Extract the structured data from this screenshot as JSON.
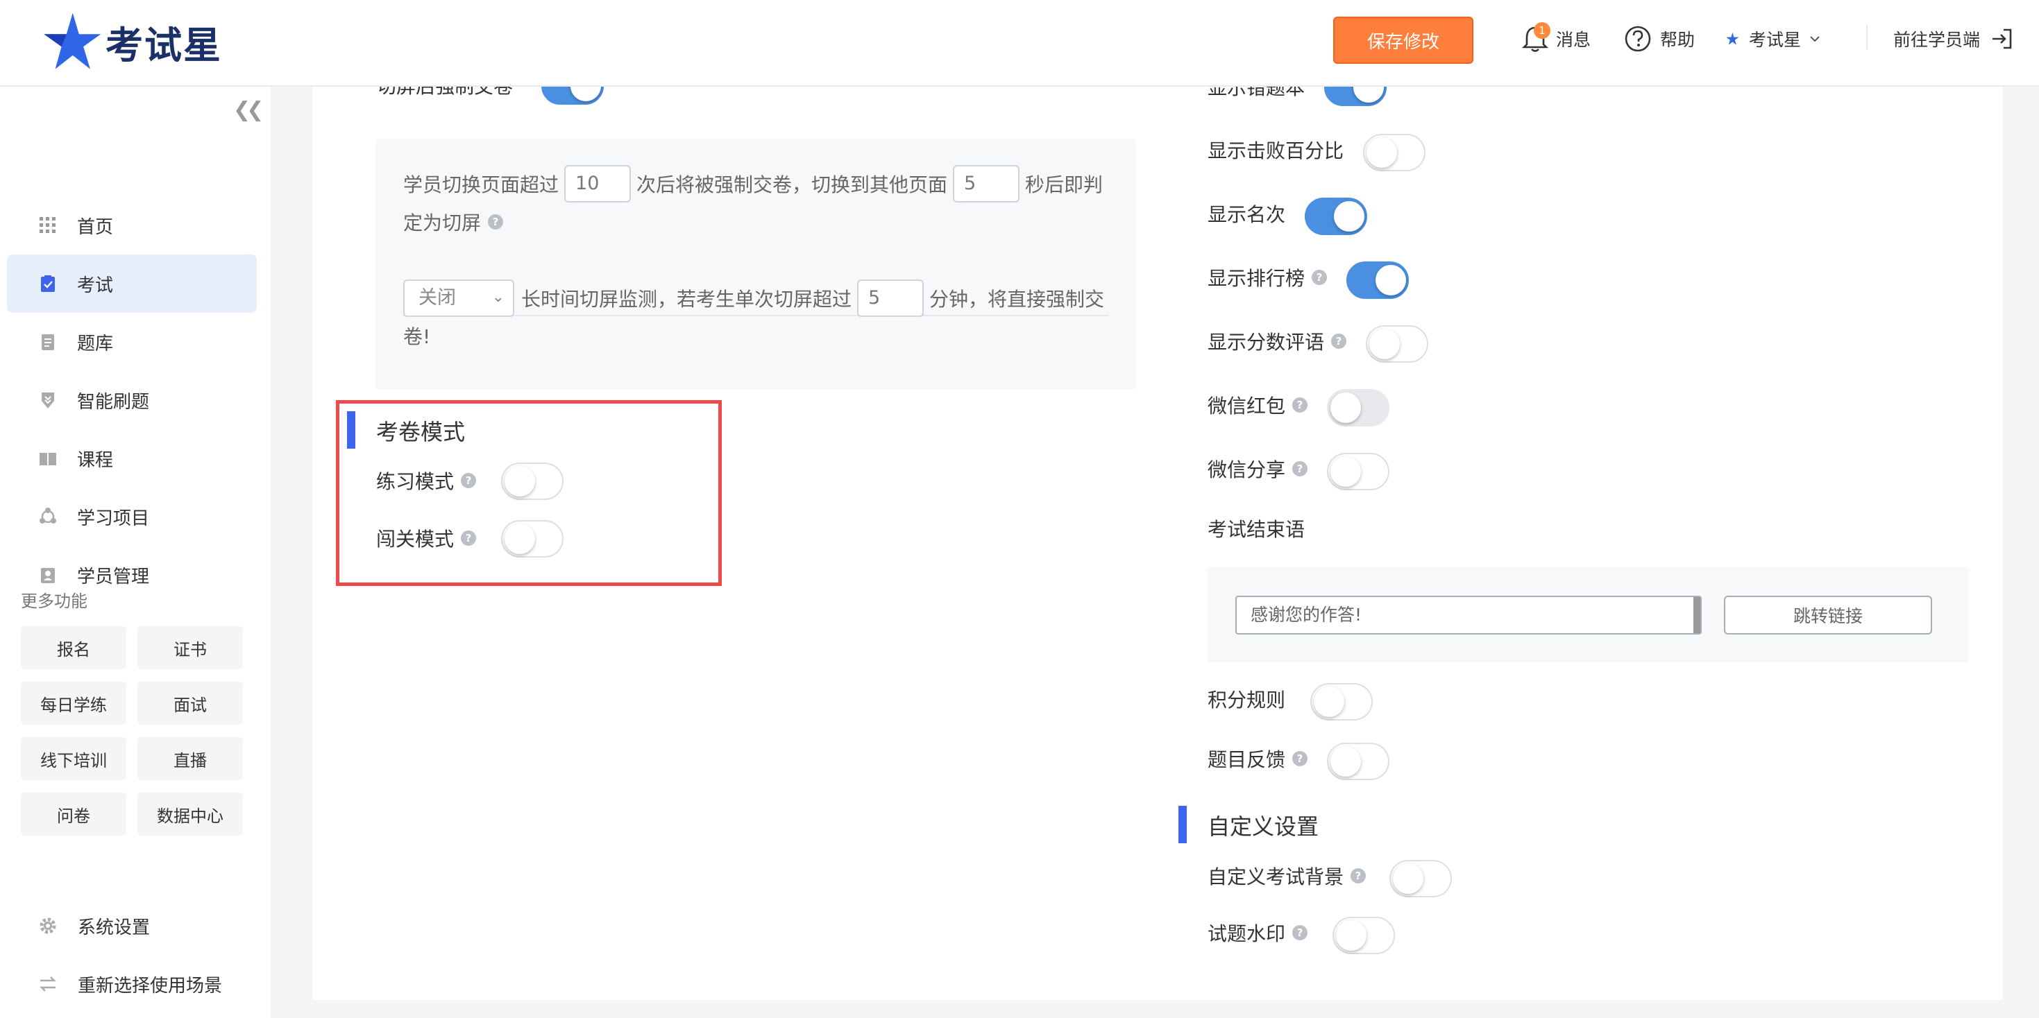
{
  "header": {
    "logo_text": "考试星",
    "save_label": "保存修改",
    "message_label": "消息",
    "message_badge": "1",
    "help_label": "帮助",
    "account_label": "考试星",
    "student_label": "前往学员端"
  },
  "sidebar": {
    "items": [
      {
        "label": "首页"
      },
      {
        "label": "考试",
        "active": true
      },
      {
        "label": "题库"
      },
      {
        "label": "智能刷题"
      },
      {
        "label": "课程"
      },
      {
        "label": "学习项目"
      },
      {
        "label": "学员管理"
      }
    ],
    "more_label": "更多功能",
    "more_items": [
      "报名",
      "证书",
      "每日学练",
      "面试",
      "线下培训",
      "直播",
      "问卷",
      "数据中心"
    ],
    "settings_label": "系统设置",
    "switch_label": "重新选择使用场景"
  },
  "left": {
    "force_submit_label": "切屏后强制交卷",
    "force_submit_on": true,
    "switch_text_1": "学员切换页面超过",
    "switch_count": "10",
    "switch_text_2": "次后将被强制交卷，切换到其他页面",
    "switch_seconds": "5",
    "switch_text_3": "秒后即判",
    "switch_text_4": "定为切屏",
    "monitor_select": "关闭",
    "monitor_text_1": "长时间切屏监测，若考生单次切屏超过",
    "monitor_minutes": "5",
    "monitor_text_2": "分钟，将直接强制交",
    "monitor_text_3": "卷!",
    "exam_mode_title": "考卷模式",
    "practice_label": "练习模式",
    "practice_on": false,
    "level_label": "闯关模式",
    "level_on": false
  },
  "right": {
    "wrongbook_label": "显示错题本",
    "wrongbook_on": true,
    "defeat_label": "显示击败百分比",
    "defeat_on": false,
    "rank_label": "显示名次",
    "rank_on": true,
    "leaderboard_label": "显示排行榜",
    "leaderboard_on": true,
    "score_comment_label": "显示分数评语",
    "score_comment_on": false,
    "redpacket_label": "微信红包",
    "redpacket_on": false,
    "share_label": "微信分享",
    "share_on": false,
    "end_label": "考试结束语",
    "end_value": "感谢您的作答!",
    "jump_link_label": "跳转链接",
    "points_label": "积分规则",
    "points_on": false,
    "feedback_label": "题目反馈",
    "feedback_on": false,
    "custom_title": "自定义设置",
    "custom_bg_label": "自定义考试背景",
    "custom_bg_on": false,
    "watermark_label": "试题水印",
    "watermark_on": false
  },
  "colors": {
    "accent": "#4a8fe0",
    "save_button": "#ff7e3b",
    "section_bar": "#3e63ec",
    "highlight_box": "#ef4a4a"
  }
}
